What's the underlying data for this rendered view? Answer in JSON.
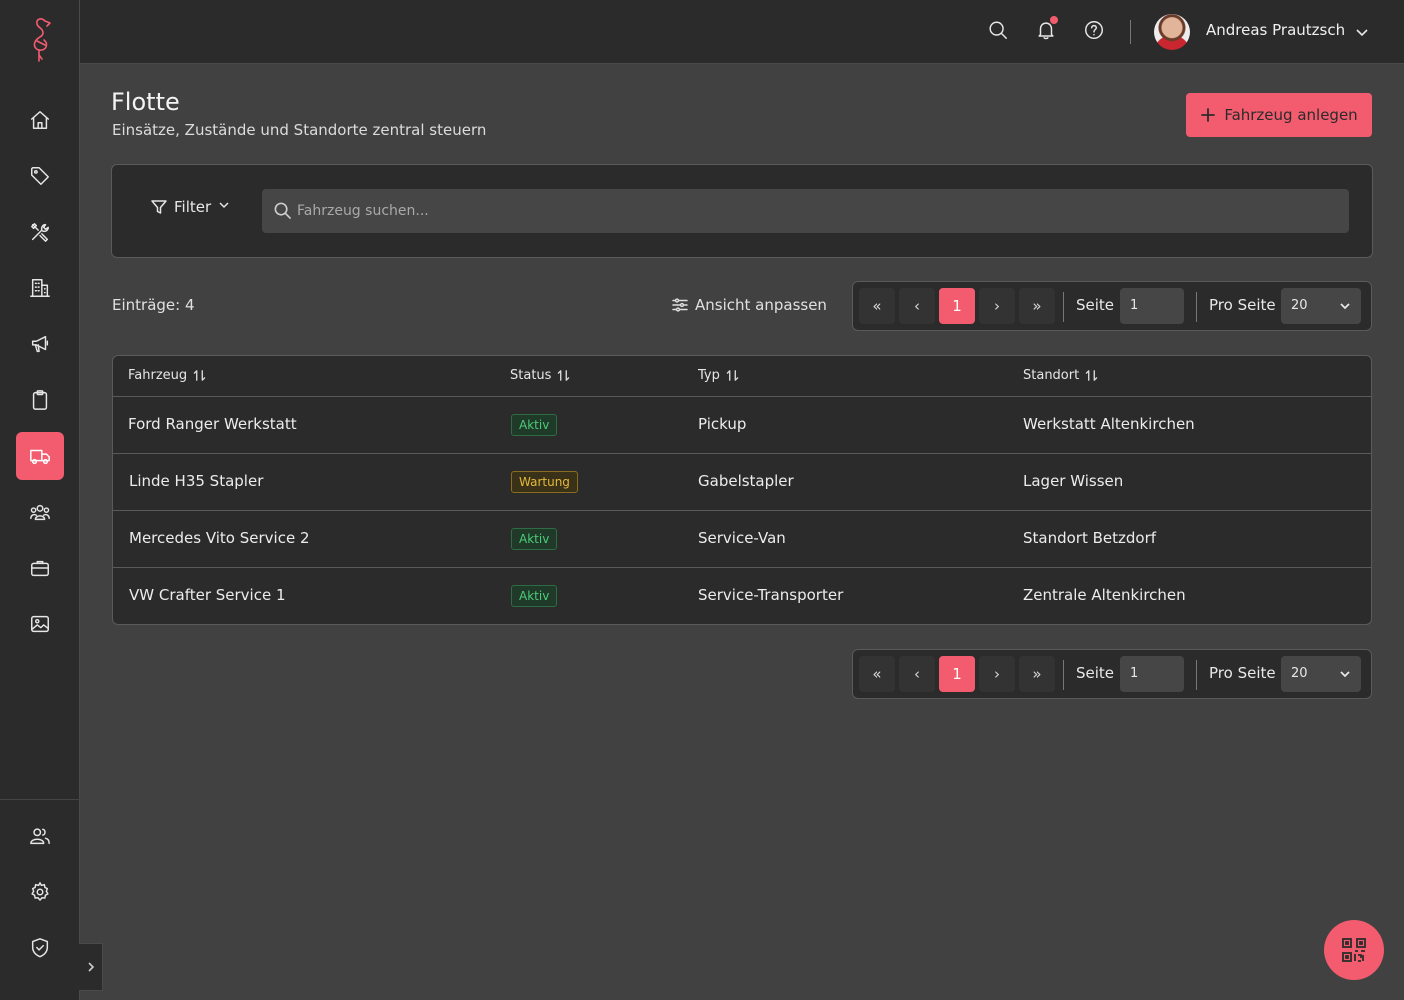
{
  "app": {
    "logo_icon": "flamingo-logo"
  },
  "sidebar": {
    "items": [
      {
        "id": "home",
        "icon": "home-icon"
      },
      {
        "id": "tags",
        "icon": "tag-icon"
      },
      {
        "id": "tools",
        "icon": "tools-icon"
      },
      {
        "id": "buildings",
        "icon": "building-icon"
      },
      {
        "id": "campaigns",
        "icon": "megaphone-icon"
      },
      {
        "id": "tasks",
        "icon": "clipboard-icon"
      },
      {
        "id": "fleet",
        "icon": "truck-icon",
        "active": true
      },
      {
        "id": "teams",
        "icon": "team-icon"
      },
      {
        "id": "jobs",
        "icon": "briefcase-icon"
      },
      {
        "id": "media",
        "icon": "image-icon"
      },
      {
        "id": "users",
        "icon": "users-icon"
      },
      {
        "id": "settings",
        "icon": "gear-icon"
      },
      {
        "id": "security",
        "icon": "shield-check-icon"
      }
    ]
  },
  "topbar": {
    "user_name": "Andreas Prautzsch",
    "has_notification": true
  },
  "page": {
    "title": "Flotte",
    "subtitle": "Einsätze, Zustände und Standorte zentral steuern",
    "add_button_label": "Fahrzeug anlegen"
  },
  "filter": {
    "button_label": "Filter",
    "search_placeholder": "Fahrzeug suchen..."
  },
  "toolbar": {
    "entries_label": "Einträge: 4",
    "customize_label": "Ansicht anpassen"
  },
  "pagination": {
    "first": "«",
    "prev": "‹",
    "current_page": "1",
    "next": "›",
    "last": "»",
    "page_label": "Seite",
    "page_input": "1",
    "per_page_label": "Pro Seite",
    "per_page_value": "20"
  },
  "table": {
    "columns": [
      "Fahrzeug",
      "Status",
      "Typ",
      "Standort"
    ],
    "rows": [
      {
        "vehicle": "Ford Ranger Werkstatt",
        "status": "Aktiv",
        "status_kind": "aktiv",
        "type": "Pickup",
        "location": "Werkstatt Altenkirchen"
      },
      {
        "vehicle": "Linde H35 Stapler",
        "status": "Wartung",
        "status_kind": "wartung",
        "type": "Gabelstapler",
        "location": "Lager Wissen"
      },
      {
        "vehicle": "Mercedes Vito Service 2",
        "status": "Aktiv",
        "status_kind": "aktiv",
        "type": "Service-Van",
        "location": "Standort Betzdorf"
      },
      {
        "vehicle": "VW Crafter Service 1",
        "status": "Aktiv",
        "status_kind": "aktiv",
        "type": "Service-Transporter",
        "location": "Zentrale Altenkirchen"
      }
    ]
  },
  "colors": {
    "accent": "#f25c6e",
    "background": "#414141",
    "panel": "#2b2b2b",
    "status_active": "#4ccb78",
    "status_maintenance": "#e6b93a"
  },
  "fab": {
    "icon": "qr-code-icon"
  }
}
